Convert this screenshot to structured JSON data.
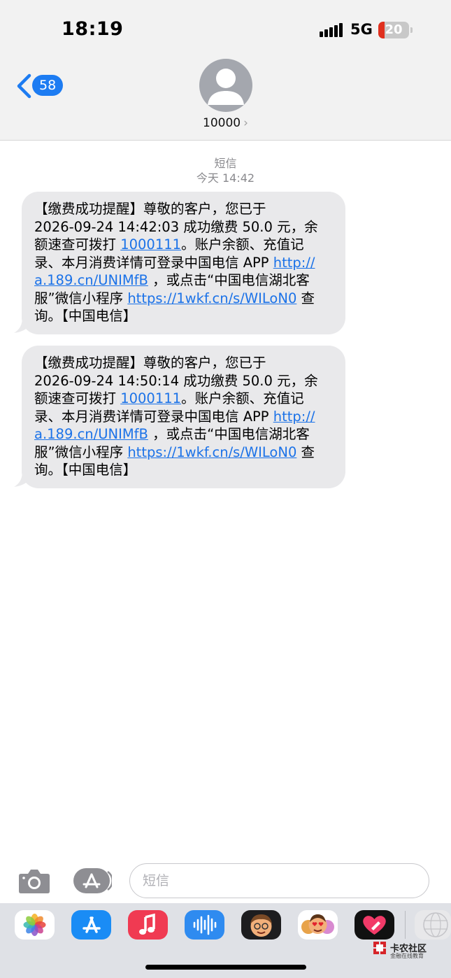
{
  "status_bar": {
    "time": "18:19",
    "network": "5G",
    "battery_level": "20",
    "battery_fraction": 0.2
  },
  "header": {
    "back_badge_count": "58",
    "contact_name": "10000",
    "contact_chevron": "›"
  },
  "conversation": {
    "service_label": "短信",
    "timestamp": "今天 14:42",
    "messages": [
      {
        "lines": [
          [
            {
              "t": "【缴费成功提醒】尊敬的客户，您已于"
            }
          ],
          [
            {
              "t": "2026-09-24 14:42:03 成功缴费 50.0 元，余"
            }
          ],
          [
            {
              "t": "额速查可拨打 "
            },
            {
              "t": "1000111",
              "link": true
            },
            {
              "t": "。账户余额、充值记"
            }
          ],
          [
            {
              "t": "录、本月消费详情可登录中国电信 APP "
            },
            {
              "t": "http://",
              "link": true
            }
          ],
          [
            {
              "t": "a.189.cn/UNIMfB",
              "link": true
            },
            {
              "t": " ，或点击“中国电信湖北客"
            }
          ],
          [
            {
              "t": "服”微信小程序 "
            },
            {
              "t": "https://1wkf.cn/s/WILoN0",
              "link": true
            },
            {
              "t": " 查"
            }
          ],
          [
            {
              "t": "询。【中国电信】"
            }
          ]
        ]
      },
      {
        "lines": [
          [
            {
              "t": "【缴费成功提醒】尊敬的客户，您已于"
            }
          ],
          [
            {
              "t": "2026-09-24 14:50:14 成功缴费 50.0 元，余"
            }
          ],
          [
            {
              "t": "额速查可拨打 "
            },
            {
              "t": "1000111",
              "link": true
            },
            {
              "t": "。账户余额、充值记"
            }
          ],
          [
            {
              "t": "录、本月消费详情可登录中国电信 APP "
            },
            {
              "t": "http://",
              "link": true
            }
          ],
          [
            {
              "t": "a.189.cn/UNIMfB",
              "link": true
            },
            {
              "t": " ，或点击“中国电信湖北客"
            }
          ],
          [
            {
              "t": "服”微信小程序 "
            },
            {
              "t": "https://1wkf.cn/s/WILoN0",
              "link": true
            },
            {
              "t": " 查"
            }
          ],
          [
            {
              "t": "询。【中国电信】"
            }
          ]
        ]
      }
    ]
  },
  "input_bar": {
    "placeholder": "短信"
  },
  "app_tray": {
    "apps": [
      "photos-icon",
      "app-store-icon",
      "music-icon",
      "audio-message-icon",
      "memoji-icon",
      "memoji-stickers-icon",
      "digital-touch-icon",
      "more-apps-icon"
    ]
  },
  "watermark": {
    "title": "卡农社区",
    "subtitle": "金融在线教育"
  },
  "colors": {
    "link": "#1b72e8",
    "bubble": "#e9e9eb",
    "badge": "#1d7cf2",
    "battery_low": "#e0301e"
  }
}
